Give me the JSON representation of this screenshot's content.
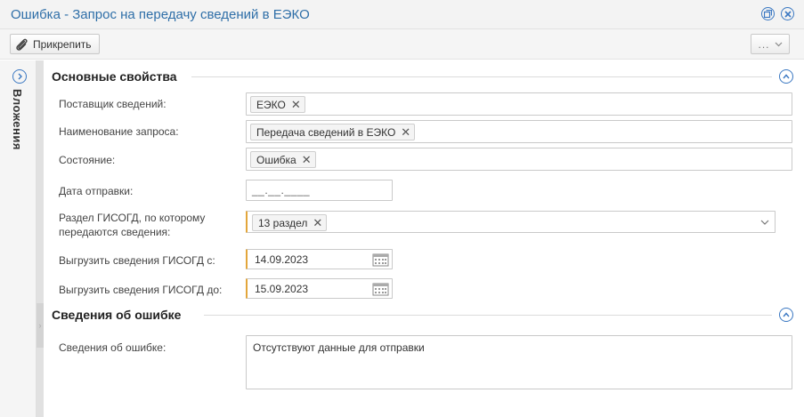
{
  "window": {
    "title": "Ошибка - Запрос на передачу сведений в ЕЭКО",
    "buttons": [
      "restore-icon",
      "close-icon"
    ]
  },
  "toolbar": {
    "attach_label": "Прикрепить",
    "more_label": "..."
  },
  "sidebar": {
    "label": "Вложения"
  },
  "sections": {
    "main": {
      "title": "Основные свойства",
      "fields": {
        "supplier_label": "Поставщик сведений:",
        "supplier_value": "ЕЭКО",
        "request_name_label": "Наименование запроса:",
        "request_name_value": "Передача сведений в ЕЭКО",
        "state_label": "Состояние:",
        "state_value": "Ошибка",
        "send_date_label": "Дата отправки:",
        "send_date_placeholder": "__.__.____",
        "section_label_line1": "Раздел ГИСОГД, по которому",
        "section_label_line2": "передаются сведения:",
        "section_value": "13 раздел",
        "export_from_label": "Выгрузить сведения ГИСОГД с:",
        "export_from_value": "14.09.2023",
        "export_to_label": "Выгрузить сведения ГИСОГД до:",
        "export_to_value": "15.09.2023"
      }
    },
    "error": {
      "title": "Сведения об ошибке",
      "fields": {
        "error_info_label": "Сведения об ошибке:",
        "error_info_value": "Отсутствуют данные для отправки"
      }
    }
  },
  "colors": {
    "accent": "#3b78c2",
    "title": "#2f6fa8",
    "required": "#e3a63b"
  }
}
